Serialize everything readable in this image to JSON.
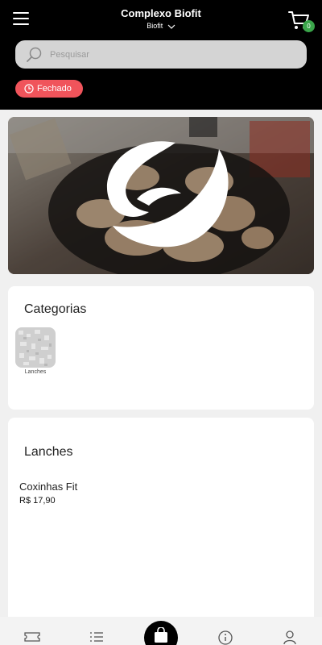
{
  "header": {
    "store_name": "Complexo Biofit",
    "store_selector": "Biofit",
    "cart_count": "0"
  },
  "search": {
    "placeholder": "Pesquisar"
  },
  "status": {
    "label": "Fechado",
    "color": "#f0545b"
  },
  "categories": {
    "title": "Categorias",
    "items": [
      {
        "label": "Lanches"
      }
    ]
  },
  "products_section": {
    "title": "Lanches",
    "items": [
      {
        "name": "Coxinhas Fit",
        "price": "R$ 17,90"
      }
    ]
  },
  "bottom_nav": {
    "items": [
      {
        "icon": "ticket-icon"
      },
      {
        "icon": "list-icon"
      },
      {
        "icon": "shopping-bag-icon"
      },
      {
        "icon": "info-icon"
      },
      {
        "icon": "user-icon"
      }
    ]
  },
  "colors": {
    "accent_green": "#3aa54a",
    "header_bg": "#000000"
  }
}
